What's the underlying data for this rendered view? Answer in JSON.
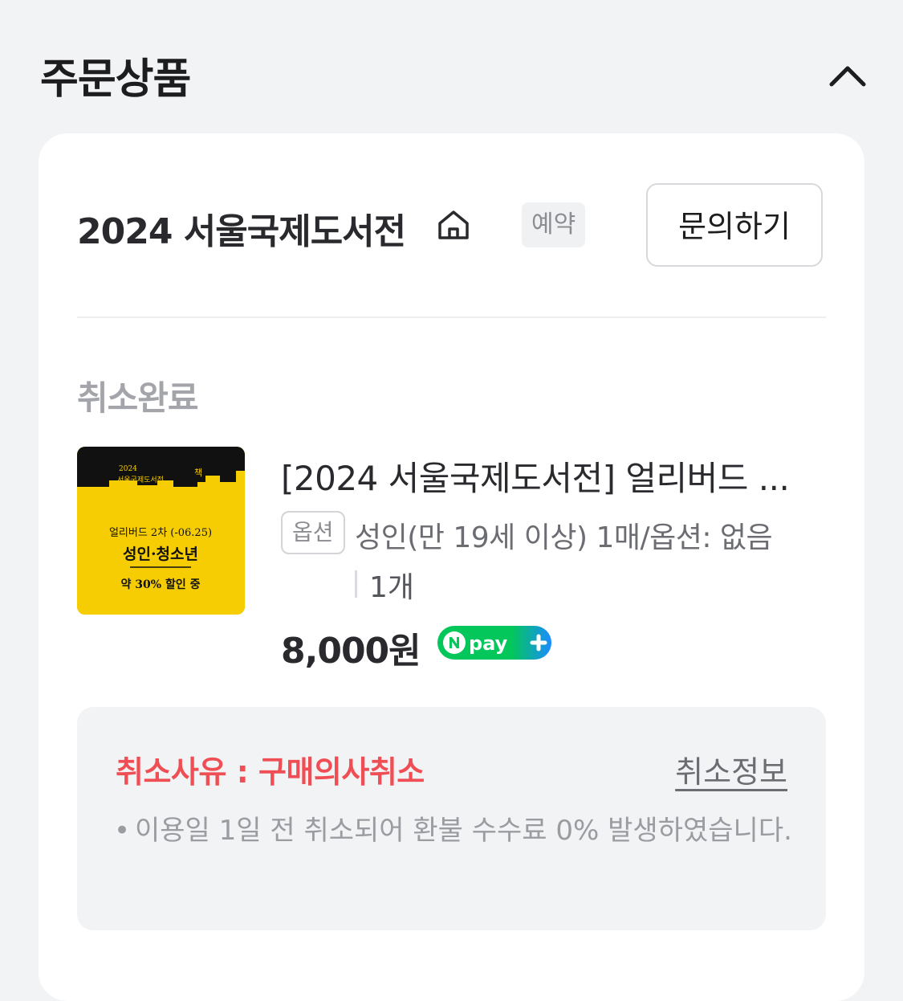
{
  "section": {
    "title": "주문상품",
    "collapse_icon": "chevron-up-icon"
  },
  "store": {
    "name": "2024 서울국제도서전",
    "home_icon": "home-icon",
    "badge": "예약",
    "inquiry_button": "문의하기"
  },
  "order": {
    "status": "취소완료",
    "product": {
      "title": "[2024 서울국제도서전] 얼리버드 ...",
      "option_badge": "옵션",
      "option_text": "성인(만 19세 이상) 1매/옵션: 없음",
      "quantity": "1개",
      "price": "8,000원",
      "payment_badge_icon": "npay-plus-icon",
      "thumbnail": {
        "year": "2024",
        "event": "서울국제도서전",
        "mark": "책",
        "line1": "얼리버드 2차 (-06.25)",
        "line2": "성인·청소년",
        "line3": "약 30% 할인 중"
      }
    }
  },
  "cancel": {
    "reason": "취소사유 : 구매의사취소",
    "info_link": "취소정보",
    "bullet": "•",
    "note": "이용일 1일 전 취소되어 환불 수수료 0% 발생하였습니다."
  },
  "colors": {
    "background": "#f2f3f5",
    "card": "#ffffff",
    "cancel_red": "#f04e55",
    "thumbnail_yellow": "#f6cd02",
    "npay_green": "#03c75a"
  }
}
